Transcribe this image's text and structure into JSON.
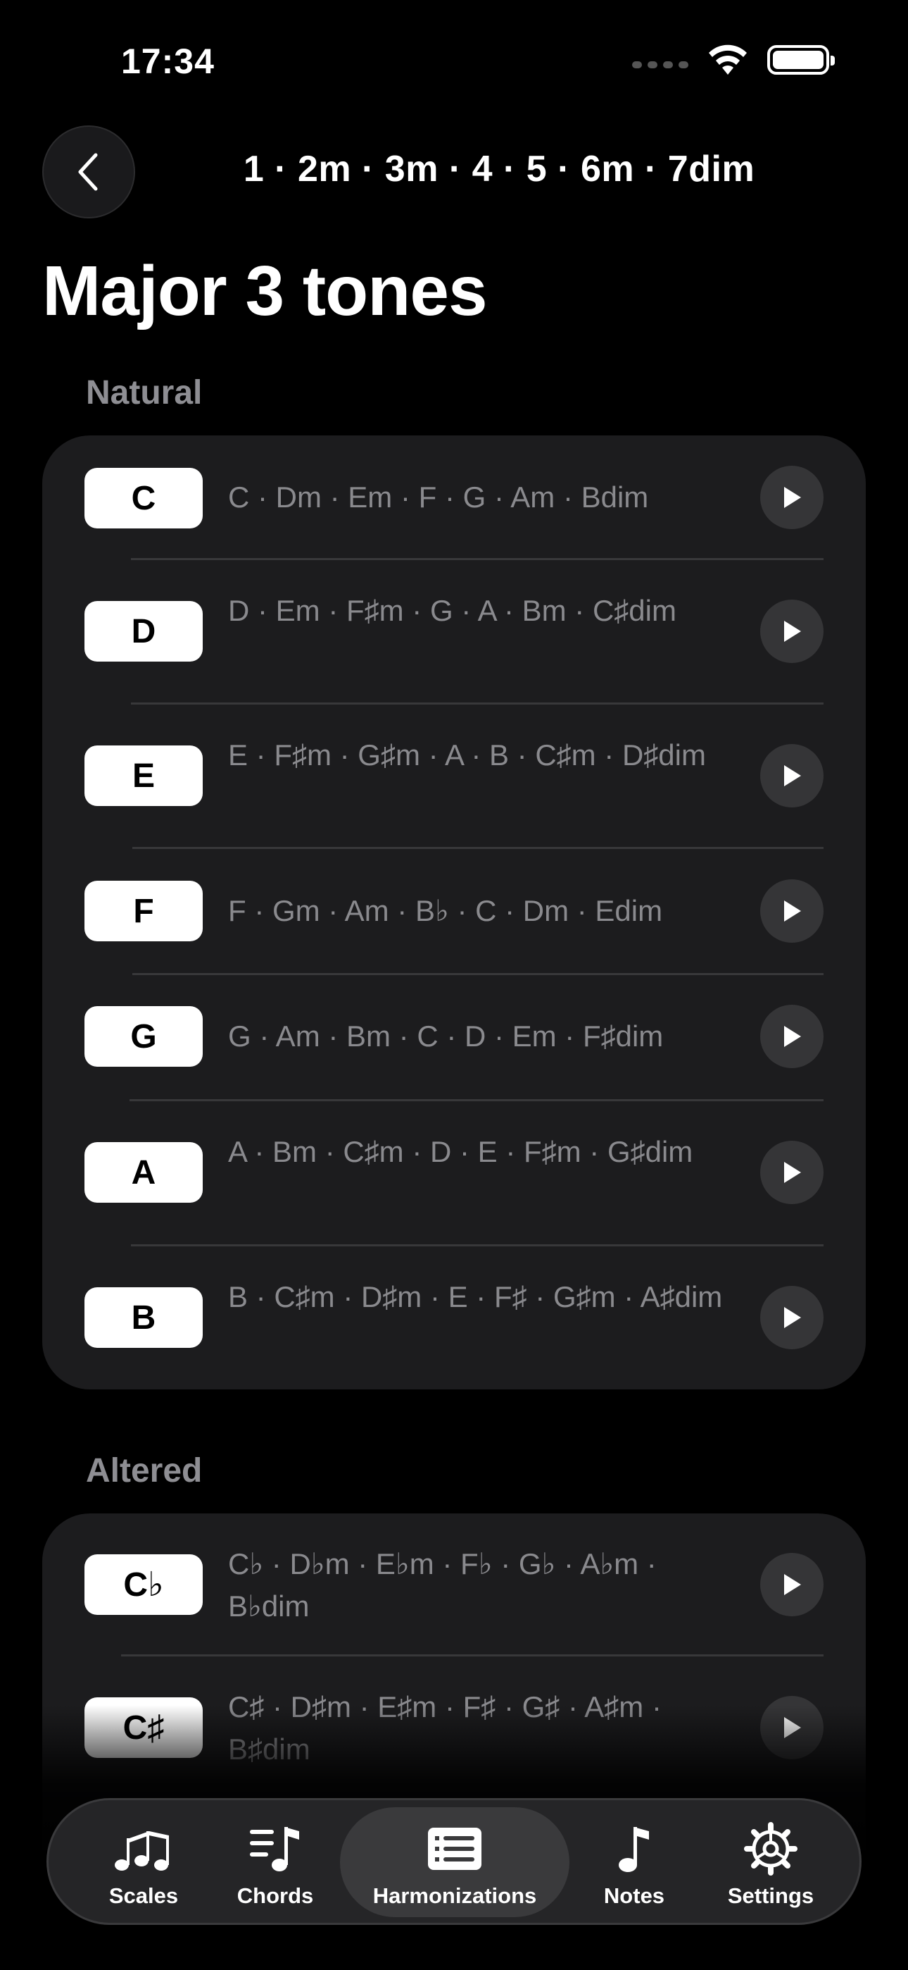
{
  "status": {
    "time": "17:34"
  },
  "header": {
    "formula": "1 · 2m · 3m · 4 · 5 · 6m · 7dim",
    "title": "Major 3 tones"
  },
  "sections": {
    "natural": {
      "label": "Natural",
      "rows": [
        {
          "key": "C",
          "chords": "C · Dm · Em · F · G · Am · Bdim"
        },
        {
          "key": "D",
          "chords": "D · Em · F♯m · G · A · Bm · C♯dim"
        },
        {
          "key": "E",
          "chords": "E · F♯m · G♯m · A · B · C♯m · D♯dim"
        },
        {
          "key": "F",
          "chords": "F · Gm · Am · B♭ · C · Dm · Edim"
        },
        {
          "key": "G",
          "chords": "G · Am · Bm · C · D · Em · F♯dim"
        },
        {
          "key": "A",
          "chords": "A · Bm · C♯m · D · E · F♯m · G♯dim"
        },
        {
          "key": "B",
          "chords": "B · C♯m · D♯m · E · F♯ · G♯m · A♯dim"
        }
      ]
    },
    "altered": {
      "label": "Altered",
      "rows": [
        {
          "key": "C♭",
          "chords": "C♭ · D♭m · E♭m · F♭ · G♭ · A♭m · B♭dim"
        },
        {
          "key": "C♯",
          "chords": "C♯ · D♯m · E♯m · F♯ · G♯ · A♯m · B♯dim"
        }
      ]
    }
  },
  "tabs": [
    {
      "label": "Scales",
      "icon": "scales-notes-icon"
    },
    {
      "label": "Chords",
      "icon": "chords-icon"
    },
    {
      "label": "Harmonizations",
      "icon": "harmonizations-list-icon",
      "selected": true
    },
    {
      "label": "Notes",
      "icon": "music-note-icon"
    },
    {
      "label": "Settings",
      "icon": "gear-icon"
    }
  ]
}
